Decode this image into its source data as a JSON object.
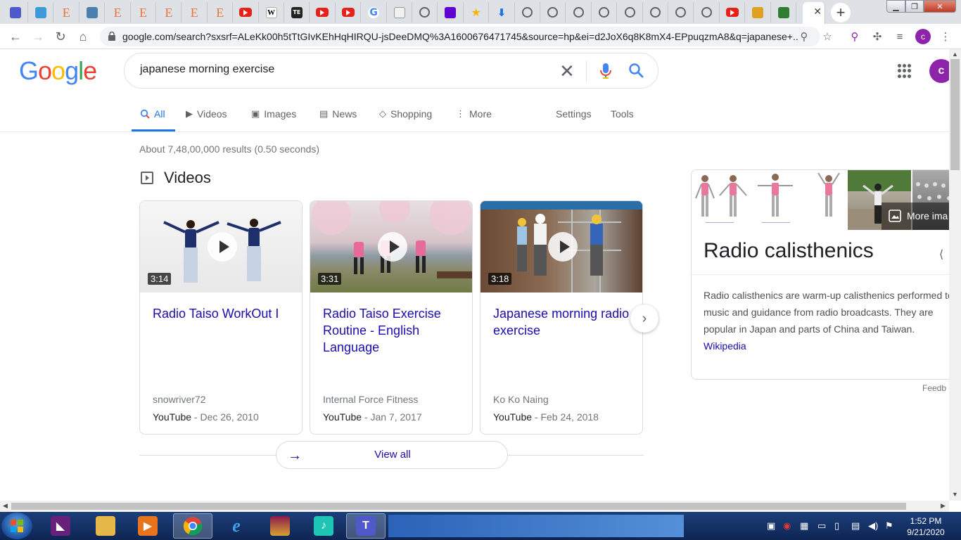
{
  "browser": {
    "tabs": [
      {
        "icon": "teams-icon",
        "color": "#5059c9"
      },
      {
        "icon": "edge-icon",
        "color": "#3c9bd8"
      },
      {
        "icon": "e-icon",
        "label": "E"
      },
      {
        "icon": "ship-icon",
        "color": "#4a7fb0"
      },
      {
        "icon": "e-icon",
        "label": "E"
      },
      {
        "icon": "e-icon",
        "label": "E"
      },
      {
        "icon": "e-icon",
        "label": "E"
      },
      {
        "icon": "e-icon",
        "label": "E"
      },
      {
        "icon": "e-icon",
        "label": "E"
      },
      {
        "icon": "youtube-icon"
      },
      {
        "icon": "wikipedia-icon",
        "label": "W"
      },
      {
        "icon": "te-icon",
        "label": "TE"
      },
      {
        "icon": "youtube-icon"
      },
      {
        "icon": "youtube-icon"
      },
      {
        "icon": "google-icon",
        "label": "G"
      },
      {
        "icon": "site-icon"
      },
      {
        "icon": "globe-icon"
      },
      {
        "icon": "mail-icon",
        "color": "#6001d2"
      },
      {
        "icon": "star-icon",
        "label": "★"
      },
      {
        "icon": "download-icon",
        "label": "⬇"
      },
      {
        "icon": "globe-icon"
      },
      {
        "icon": "globe-icon"
      },
      {
        "icon": "globe-icon"
      },
      {
        "icon": "globe-icon"
      },
      {
        "icon": "globe-icon"
      },
      {
        "icon": "globe-icon"
      },
      {
        "icon": "globe-icon"
      },
      {
        "icon": "globe-icon"
      },
      {
        "icon": "youtube-icon"
      },
      {
        "icon": "award-icon",
        "color": "#e0a020"
      },
      {
        "icon": "gov-icon",
        "color": "#2e7d32"
      }
    ],
    "new_tab_label": "+",
    "url": "google.com/search?sxsrf=ALeKk00h5tTtGIvKEhHqHIRQU-jsDeeDMQ%3A1600676471745&source=hp&ei=d2JoX6q8K8mX4-EPpuqzmA8&q=japanese+...",
    "profile_initial": "c"
  },
  "search": {
    "query": "japanese morning exercise",
    "account_initial": "c",
    "logo_letters": [
      {
        "ch": "G",
        "color": "#4285f4"
      },
      {
        "ch": "o",
        "color": "#ea4335"
      },
      {
        "ch": "o",
        "color": "#fbbc05"
      },
      {
        "ch": "g",
        "color": "#4285f4"
      },
      {
        "ch": "l",
        "color": "#34a853"
      },
      {
        "ch": "e",
        "color": "#ea4335"
      }
    ]
  },
  "nav": {
    "all": "All",
    "videos": "Videos",
    "images": "Images",
    "news": "News",
    "shopping": "Shopping",
    "more": "More",
    "settings": "Settings",
    "tools": "Tools"
  },
  "results": {
    "stats": "About 7,48,00,000 results (0.50 seconds)"
  },
  "videos": {
    "heading": "Videos",
    "items": [
      {
        "title": "Radio Taiso WorkOut I",
        "duration": "3:14",
        "channel": "snowriver72",
        "source": "YouTube",
        "date": " - Dec 26, 2010"
      },
      {
        "title": "Radio Taiso Exercise Routine - English Language",
        "duration": "3:31",
        "channel": "Internal Force Fitness",
        "source": "YouTube",
        "date": " - Jan 7, 2017"
      },
      {
        "title": "Japanese morning radio exercise",
        "duration": "3:18",
        "channel": "Ko Ko Naing",
        "source": "YouTube",
        "date": " - Feb 24, 2018"
      }
    ],
    "view_all": "View all"
  },
  "knowledge_panel": {
    "title": "Radio calisthenics",
    "more_images": "More ima",
    "description": "Radio calisthenics are warm-up calisthenics performed to music and guidance from radio broadcasts. They are popular in Japan and parts of China and Taiwan.",
    "source_link": "Wikipedia",
    "feedback": "Feedb"
  },
  "taskbar": {
    "clock_time": "1:52 PM",
    "clock_date": "9/21/2020"
  }
}
